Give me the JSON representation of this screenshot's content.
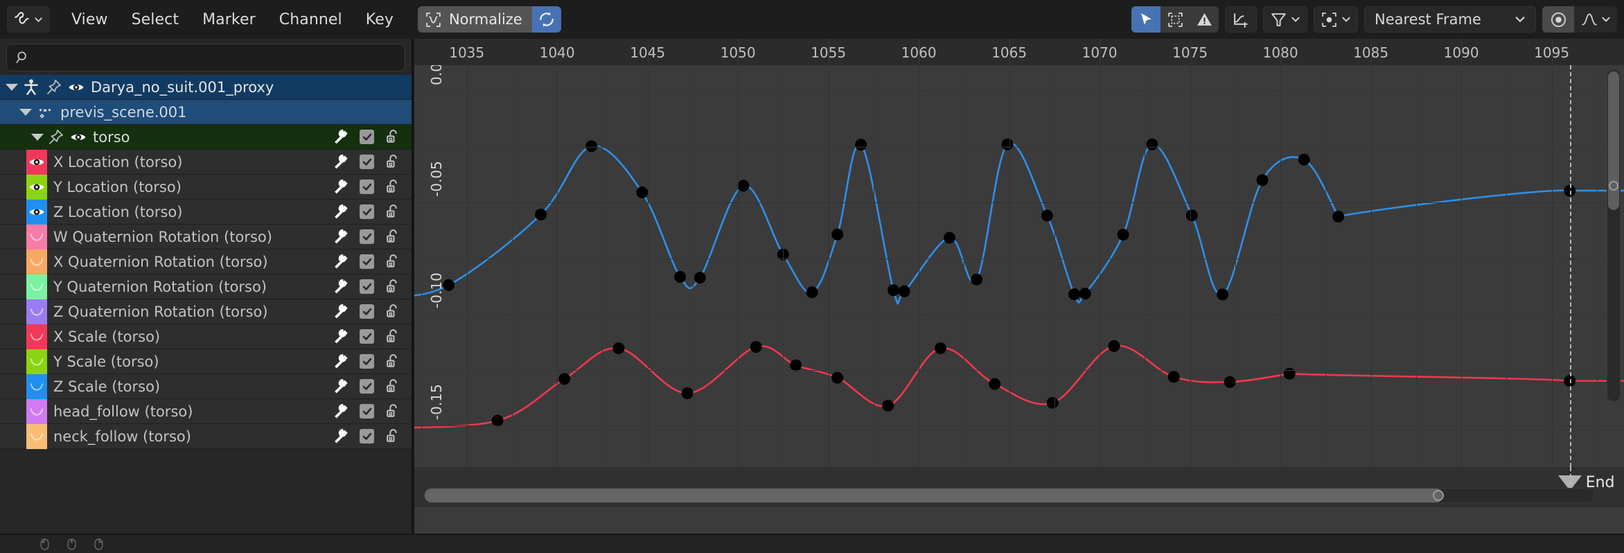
{
  "header": {
    "editor_type_icon": "graph-editor-icon",
    "menus": [
      "View",
      "Select",
      "Marker",
      "Channel",
      "Key"
    ],
    "normalize": {
      "icon": "normalize-icon",
      "label": "Normalize",
      "refresh_icon": "auto-refresh-icon",
      "refresh_active": true
    },
    "tools": [
      {
        "name": "cursor-select-tool",
        "icon": "cursor-icon",
        "active": true
      },
      {
        "name": "box-select-tool",
        "icon": "box-select-icon",
        "active": false
      },
      {
        "name": "only-selected-curve-keyframes",
        "icon": "warning-triangle-icon",
        "active": false
      },
      {
        "name": "show-handles-toggle",
        "icon": "curve-handles-icon",
        "active": false
      }
    ],
    "filter": {
      "name": "filter-dropdown",
      "icon": "funnel-icon"
    },
    "pivot": {
      "name": "pivot-point-dropdown",
      "icon": "pivot-center-icon"
    },
    "snap": {
      "label": "Nearest Frame",
      "chevron": "chevron-down-icon"
    },
    "proportional": {
      "toggle_icon": "proportional-edit-icon",
      "falloff_icon": "smooth-falloff-icon",
      "active": true
    }
  },
  "search": {
    "placeholder": "",
    "value": "",
    "icon": "search-icon"
  },
  "channels": [
    {
      "type": "object",
      "label": "Darya_no_suit.001_proxy",
      "icon": "armature-icon",
      "pin": "pin-icon",
      "eye": "eye-icon",
      "expanded": true,
      "selected": true
    },
    {
      "type": "action",
      "label": "previs_scene.001",
      "icon": "action-icon",
      "expanded": true,
      "selected": true
    },
    {
      "type": "group",
      "label": "torso",
      "pin": "pin-icon",
      "eye": "eye-icon",
      "expanded": true,
      "modifier": true,
      "enabled": true,
      "locked": false
    },
    {
      "type": "fcurve",
      "label": "X Location (torso)",
      "color": "#F2385A",
      "visible": true,
      "modifier": true,
      "enabled": true,
      "locked": false
    },
    {
      "type": "fcurve",
      "label": "Y Location (torso)",
      "color": "#8BD411",
      "visible": true,
      "modifier": true,
      "enabled": true,
      "locked": false
    },
    {
      "type": "fcurve",
      "label": "Z Location (torso)",
      "color": "#1F8FF0",
      "visible": true,
      "modifier": true,
      "enabled": true,
      "locked": false
    },
    {
      "type": "fcurve",
      "label": "W Quaternion Rotation (torso)",
      "color": "#F97BA8",
      "visible": false,
      "modifier": true,
      "enabled": true,
      "locked": false
    },
    {
      "type": "fcurve",
      "label": "X Quaternion Rotation (torso)",
      "color": "#F9A863",
      "visible": false,
      "modifier": true,
      "enabled": true,
      "locked": false
    },
    {
      "type": "fcurve",
      "label": "Y Quaternion Rotation (torso)",
      "color": "#7BF2A0",
      "visible": false,
      "modifier": true,
      "enabled": true,
      "locked": false
    },
    {
      "type": "fcurve",
      "label": "Z Quaternion Rotation (torso)",
      "color": "#9B7BF2",
      "visible": false,
      "modifier": true,
      "enabled": true,
      "locked": false
    },
    {
      "type": "fcurve",
      "label": "X Scale (torso)",
      "color": "#F2385A",
      "visible": false,
      "modifier": true,
      "enabled": true,
      "locked": false
    },
    {
      "type": "fcurve",
      "label": "Y Scale (torso)",
      "color": "#8BD411",
      "visible": false,
      "modifier": true,
      "enabled": true,
      "locked": false
    },
    {
      "type": "fcurve",
      "label": "Z Scale (torso)",
      "color": "#1F8FF0",
      "visible": false,
      "modifier": true,
      "enabled": true,
      "locked": false
    },
    {
      "type": "fcurve",
      "label": "head_follow (torso)",
      "color": "#D07BF2",
      "visible": false,
      "modifier": true,
      "enabled": true,
      "locked": false
    },
    {
      "type": "fcurve",
      "label": "neck_follow (torso)",
      "color": "#F9BE76",
      "visible": false,
      "modifier": true,
      "enabled": true,
      "locked": false
    }
  ],
  "graph": {
    "end_marker": {
      "label": "End",
      "frame": 1096
    },
    "collapse_icon": "chevron-left-icon"
  },
  "chart_data": {
    "type": "line",
    "title": "",
    "xlabel": "",
    "ylabel": "",
    "xlim": [
      1032.1,
      1099.0
    ],
    "ylim": [
      -0.1685,
      0.0115
    ],
    "x_ticks": [
      1035,
      1040,
      1045,
      1050,
      1055,
      1060,
      1065,
      1070,
      1075,
      1080,
      1085,
      1090,
      1095
    ],
    "y_ticks": [
      0.0,
      -0.05,
      -0.1,
      -0.15
    ],
    "y_tick_labels": [
      "0.00",
      "-0.05",
      "-0.10",
      "-0.15"
    ],
    "grid": true,
    "legend": false,
    "series": [
      {
        "name": "Z Location (torso)",
        "color": "#2E8FE8",
        "keyframe_color": "#000000",
        "keyframes": [
          {
            "x": 1034.0,
            "y": -0.087
          },
          {
            "x": 1039.1,
            "y": -0.0554
          },
          {
            "x": 1041.9,
            "y": -0.0248
          },
          {
            "x": 1044.7,
            "y": -0.0455
          },
          {
            "x": 1046.8,
            "y": -0.0833
          },
          {
            "x": 1047.9,
            "y": -0.0837
          },
          {
            "x": 1050.3,
            "y": -0.0425
          },
          {
            "x": 1052.5,
            "y": -0.0733
          },
          {
            "x": 1054.1,
            "y": -0.0902
          },
          {
            "x": 1055.5,
            "y": -0.0643
          },
          {
            "x": 1056.8,
            "y": -0.0241
          },
          {
            "x": 1058.6,
            "y": -0.0893
          },
          {
            "x": 1059.2,
            "y": -0.0898
          },
          {
            "x": 1061.7,
            "y": -0.0658
          },
          {
            "x": 1063.2,
            "y": -0.0845
          },
          {
            "x": 1064.9,
            "y": -0.024
          },
          {
            "x": 1067.1,
            "y": -0.0559
          },
          {
            "x": 1068.6,
            "y": -0.0911
          },
          {
            "x": 1069.2,
            "y": -0.0908
          },
          {
            "x": 1071.3,
            "y": -0.0644
          },
          {
            "x": 1072.9,
            "y": -0.024
          },
          {
            "x": 1075.1,
            "y": -0.0558
          },
          {
            "x": 1076.8,
            "y": -0.0912
          },
          {
            "x": 1079.0,
            "y": -0.04
          },
          {
            "x": 1081.3,
            "y": -0.0308
          },
          {
            "x": 1083.2,
            "y": -0.0563
          }
        ],
        "end_value": -0.0447
      },
      {
        "name": "X Location (torso)",
        "color": "#F0384F",
        "keyframe_color": "#000000",
        "keyframes": [
          {
            "x": 1036.7,
            "y": -0.1477
          },
          {
            "x": 1040.4,
            "y": -0.129
          },
          {
            "x": 1043.4,
            "y": -0.1153
          },
          {
            "x": 1047.2,
            "y": -0.1354
          },
          {
            "x": 1051.0,
            "y": -0.1147
          },
          {
            "x": 1053.2,
            "y": -0.1229
          },
          {
            "x": 1055.5,
            "y": -0.1285
          },
          {
            "x": 1058.3,
            "y": -0.141
          },
          {
            "x": 1061.2,
            "y": -0.1153
          },
          {
            "x": 1064.2,
            "y": -0.1313
          },
          {
            "x": 1067.4,
            "y": -0.1397
          },
          {
            "x": 1070.8,
            "y": -0.1143
          },
          {
            "x": 1074.1,
            "y": -0.1281
          },
          {
            "x": 1077.2,
            "y": -0.1304
          },
          {
            "x": 1080.5,
            "y": -0.1267
          }
        ],
        "end_value": -0.1299
      }
    ]
  },
  "statusbar": {
    "items": [
      {
        "icon": "mouse-left-icon",
        "label": ""
      },
      {
        "icon": "mouse-middle-icon",
        "label": ""
      },
      {
        "icon": "mouse-right-icon",
        "label": ""
      }
    ]
  }
}
